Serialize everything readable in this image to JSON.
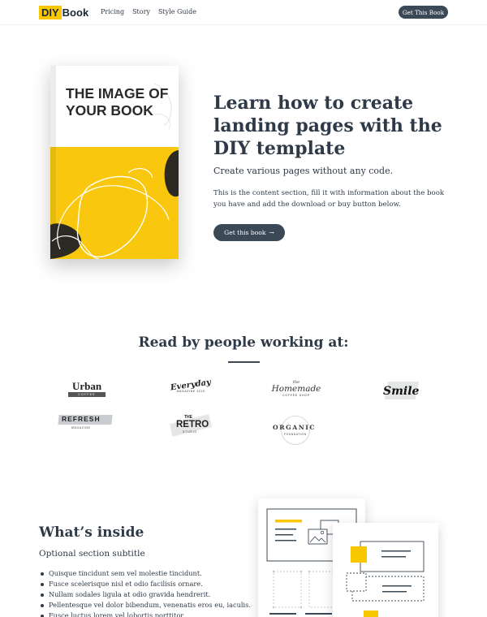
{
  "nav": {
    "logo_a": "DIY",
    "logo_b": "Book",
    "links": [
      "Pricing",
      "Story",
      "Style Guide"
    ],
    "cta": "Get This Book"
  },
  "hero": {
    "book_cover_text": "THE IMAGE OF YOUR BOOK",
    "title": "Learn how to create landing pages with the DIY template",
    "subtitle": "Create various pages without any code.",
    "body": "This is the content section, fill it with information about the book you have and add the download or buy button below.",
    "button": "Get this book",
    "button_arrow": "→"
  },
  "readers": {
    "title": "Read by people working at:",
    "logos": [
      {
        "name": "Urban",
        "sub": "COFFEE"
      },
      {
        "name": "Everyday",
        "sub": "MAGAZINE 2019"
      },
      {
        "name": "Homemade",
        "pre": "the",
        "sub": "COFFEE SHOP"
      },
      {
        "name": "Smile"
      },
      {
        "name": "REFRESH",
        "sub": "MAGAZINE"
      },
      {
        "name": "RETRO",
        "pre": "THE",
        "sub": "STUDIO"
      },
      {
        "name": "ORGANIC",
        "sub": "FOUNDATION"
      }
    ]
  },
  "inside": {
    "title": "What’s inside",
    "subtitle": "Optional section subtitle",
    "items": [
      "Quisque tincidunt sem vel molestie tincidunt.",
      "Fusce scelerisque nisl et odio facilisis ornare.",
      "Nullam sodales ligula at odio gravida hendrerit.",
      "Pellentesque vel dolor bibendum, venenatis eros eu, iaculis.",
      "Fusce luctus lorem vel lobortis porttitor."
    ]
  },
  "colors": {
    "accent": "#f8c700",
    "dark": "#3b4856",
    "text": "#2e3a47"
  }
}
